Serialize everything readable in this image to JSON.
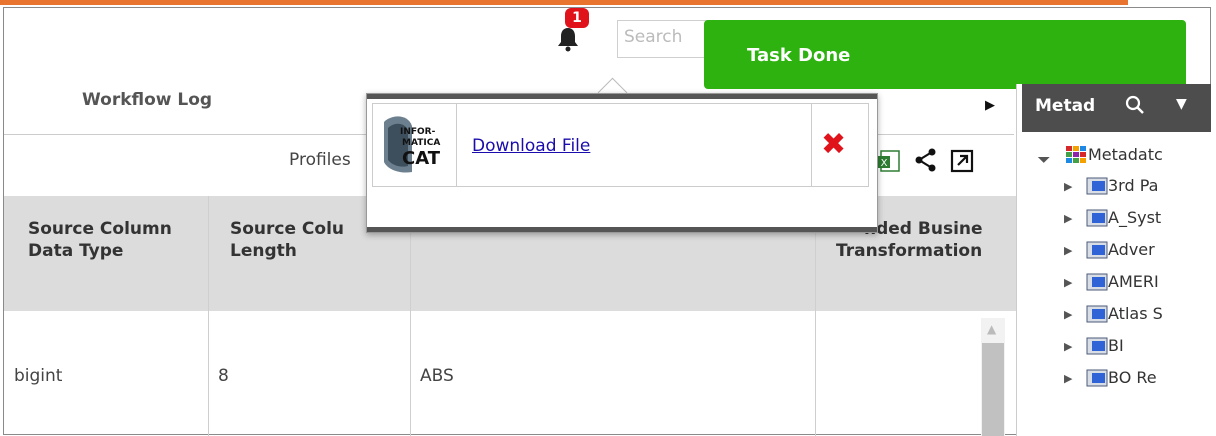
{
  "notifications": {
    "count": "1"
  },
  "search": {
    "placeholder": "Search"
  },
  "toast": {
    "message": "Task Done"
  },
  "tabs": {
    "workflow_log": "Workflow Log",
    "profiles": "Profiles"
  },
  "popover": {
    "logo_lines": [
      "INFOR-",
      "MATICA",
      "CAT"
    ],
    "download_label": "Download File"
  },
  "table": {
    "headers": [
      [
        "Source Column",
        "Data Type"
      ],
      [
        "Source Colu",
        "Length"
      ],
      [
        "",
        ""
      ],
      [
        "nded Busine",
        "Transformation"
      ]
    ],
    "rows": [
      [
        "bigint",
        "8",
        "ABS",
        ""
      ]
    ]
  },
  "right_panel": {
    "title": "Metad",
    "tree": {
      "root": "Metadatc",
      "items": [
        "3rd Pa",
        "A_Syst",
        "Adver",
        "AMERI",
        "Atlas S",
        "BI",
        "BO Re"
      ]
    }
  },
  "colors": {
    "accent": "#e8742f",
    "toast": "#2db20f",
    "badge": "#e0121a",
    "panel_header": "#4d4d4d"
  }
}
